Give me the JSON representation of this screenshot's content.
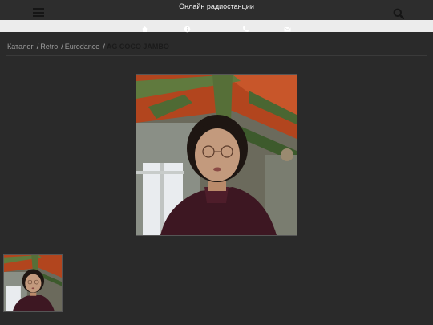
{
  "header": {
    "title": "Онлайн радиостанции",
    "menu_icon": "hamburger-menu-icon",
    "search_icon": "search-icon"
  },
  "icon_bar": {
    "icons": [
      "home-icon",
      "info-icon",
      "phone-icon",
      "mail-icon"
    ]
  },
  "breadcrumb": {
    "items": [
      "Каталог",
      "Retro",
      "Eurodance"
    ],
    "current": "AG COCO JAMBO"
  },
  "colors": {
    "background": "#2a2a2a",
    "icon_bar_bg": "#ececec",
    "title_text": "#f2f2f2",
    "breadcrumb_text": "#9a9a9a"
  }
}
